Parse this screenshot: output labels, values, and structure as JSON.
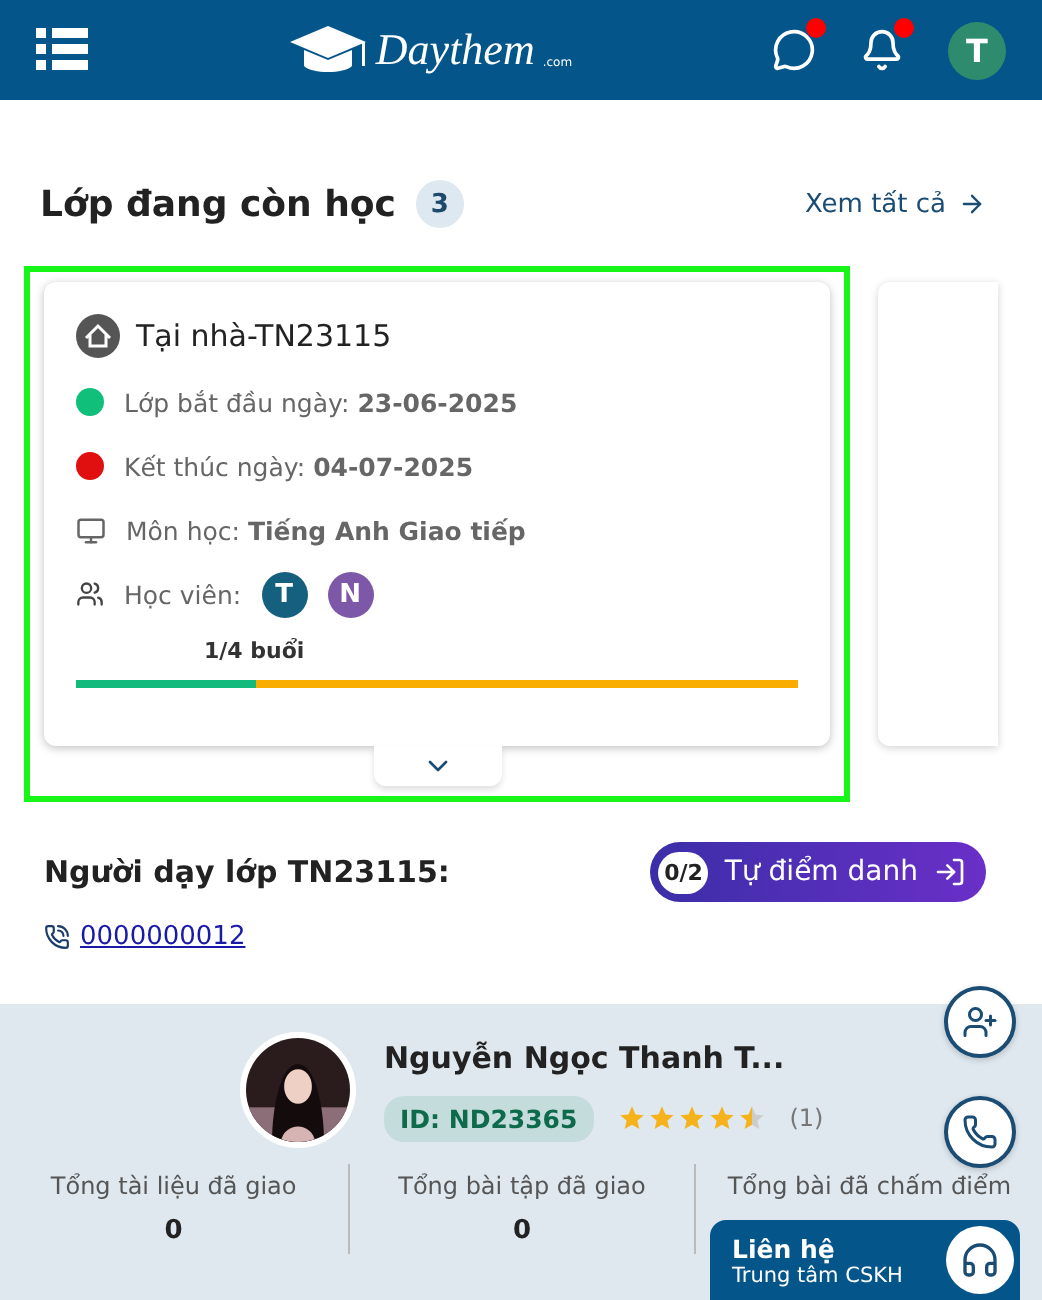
{
  "header": {
    "logo": "Daythem",
    "logo_suffix": ".com",
    "chat_unread": true,
    "notifications_unread": true,
    "user_initial": "T"
  },
  "section": {
    "title": "Lớp đang còn học",
    "count": "3",
    "see_all": "Xem tất cả"
  },
  "classes": [
    {
      "title": "Tại nhà-TN23115",
      "highlighted": true,
      "start_label": "Lớp bắt đầu ngày:",
      "start_date": "23-06-2025",
      "end_label": "Kết thúc ngày:",
      "end_date": "04-07-2025",
      "subject_label": "Môn học:",
      "subject": "Tiếng Anh Giao tiếp",
      "students_label": "Học viên:",
      "students": [
        {
          "initial": "T",
          "color": "#14607e"
        },
        {
          "initial": "N",
          "color": "#7d57a8"
        }
      ],
      "progress_label": "1/4 buổi",
      "level": 0.25
    }
  ],
  "teacher": {
    "heading": "Người dạy lớp TN23115:",
    "attendance_count": "0/2",
    "attendance_button": "Tự điểm danh",
    "phone": "0000000012",
    "name": "Nguyễn Ngọc Thanh T...",
    "id": "ID: ND23365",
    "stars": 4.5,
    "reviews": "(1)",
    "stats": [
      {
        "label": "Tổng tài liệu đã giao",
        "value": "0"
      },
      {
        "label": "Tổng bài tập đã giao",
        "value": "0"
      },
      {
        "label": "Tổng bài đã chấm điểm"
      }
    ]
  },
  "contact": {
    "title": "Liên hệ",
    "subtitle": "Trung tâm CSKH"
  }
}
